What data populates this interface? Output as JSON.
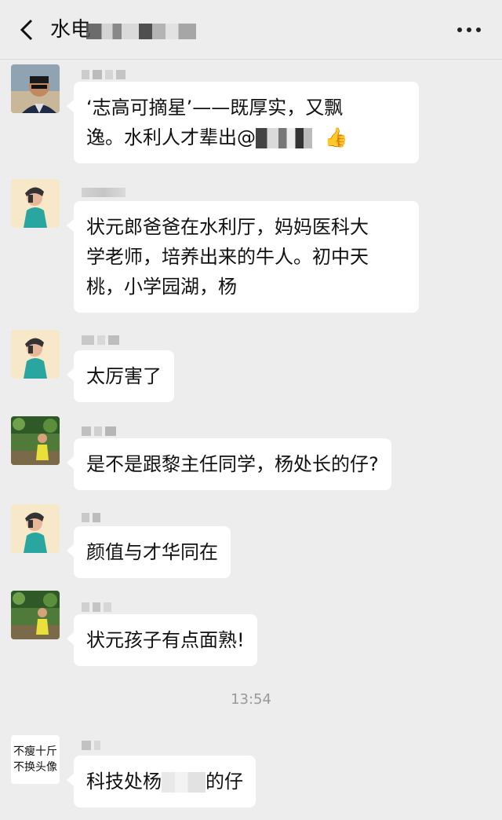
{
  "header": {
    "title": "水电",
    "back_icon": "chevron-left-icon",
    "more_icon": "more-dots-icon"
  },
  "messages": [
    {
      "sender": "",
      "lines": [
        "‘志高可摘星’——既厚实，又飘",
        "逸。水利人才辈出@"
      ],
      "emoji": "👍"
    },
    {
      "sender": "",
      "lines": [
        "状元郎爸爸在水利厅，妈妈医科大",
        "学老师，培养出来的牛人。初中天",
        "桃，小学园湖，杨"
      ]
    },
    {
      "sender": "",
      "lines": [
        "太厉害了"
      ]
    },
    {
      "sender": "",
      "lines": [
        "是不是跟黎主任同学，杨处长的仔?"
      ]
    },
    {
      "sender": "",
      "lines": [
        "颜值与才华同在"
      ]
    },
    {
      "sender": "",
      "lines": [
        "状元孩子有点面熟!"
      ]
    },
    {
      "sender": "",
      "line_before": "科技处杨",
      "line_after": "的仔",
      "avatar_text": [
        "不瘦十斤",
        "不换头像"
      ]
    }
  ],
  "timestamp": "13:54"
}
